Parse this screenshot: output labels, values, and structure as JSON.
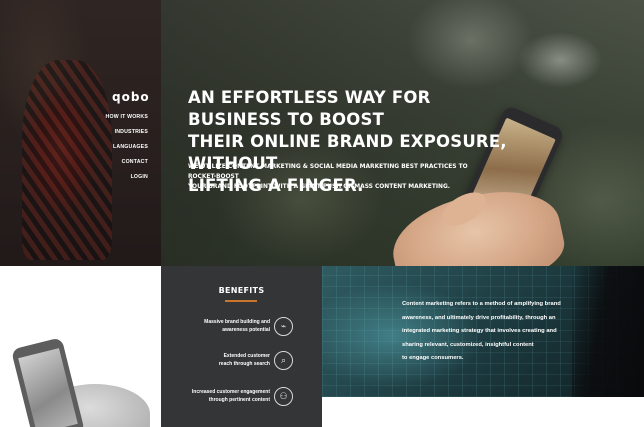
{
  "header": {
    "logo": "qobo",
    "nav": [
      "HOW IT WORKS",
      "INDUSTRIES",
      "LANGUAGES",
      "CONTACT",
      "LOGIN"
    ]
  },
  "hero": {
    "headline_lines": [
      "AN EFFORTLESS WAY FOR BUSINESS TO BOOST",
      "THEIR ONLINE BRAND EXPOSURE, WITHOUT",
      "LIFTING A FINGER."
    ],
    "sub_lines": [
      "WE UTILIZE CONTENT MARKETING & SOCIAL MEDIA MARKETING BEST PRACTICES TO ROCKET-BOOST",
      "YOUR BRAND FOOTPRINT WITH  A GIANT PUSH OF MASS CONTENT MARKETING."
    ]
  },
  "benefits": {
    "title": "BENEFITS",
    "items": [
      {
        "line1": "Massive brand building and",
        "line2": "awareness potential",
        "icon": "megaphone-icon",
        "glyph": "⌁"
      },
      {
        "line1": "Extended customer",
        "line2": "reach through search",
        "icon": "search-icon",
        "glyph": "⌕"
      },
      {
        "line1": "Increased customer engagement",
        "line2": "through pertinent content",
        "icon": "people-icon",
        "glyph": "⚇"
      }
    ]
  },
  "content_marketing": {
    "lines": [
      "Content marketing refers to a method of amplifying brand",
      "awareness, and ultimately drive profitability, through an",
      "integrated marketing strategy that involves creating and",
      "sharing relevant, customized, insightful content",
      "to engage consumers."
    ]
  },
  "colors": {
    "accent": "#c9762c",
    "benefits_bg": "#333536",
    "text_light": "#ffffff"
  }
}
